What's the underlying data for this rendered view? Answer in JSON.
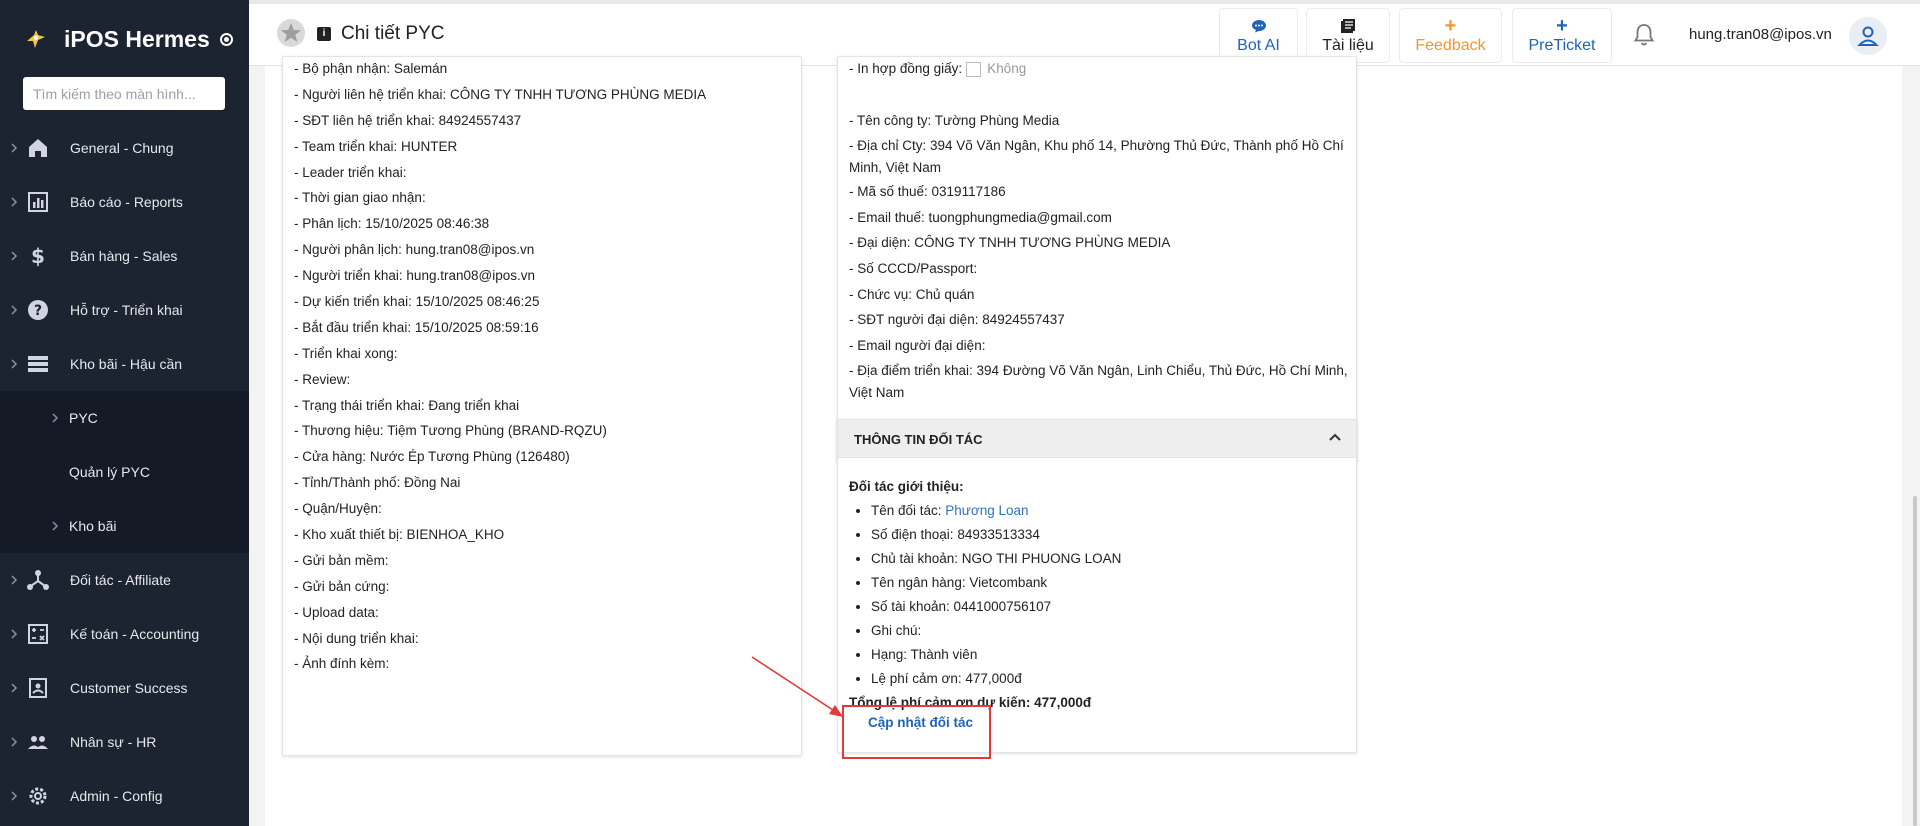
{
  "app": {
    "name": "iPOS Hermes"
  },
  "search": {
    "placeholder": "Tìm kiếm theo màn hình..."
  },
  "sidebar": {
    "items": [
      {
        "label": "General - Chung",
        "icon": "home-icon"
      },
      {
        "label": "Báo cáo - Reports",
        "icon": "chart-icon"
      },
      {
        "label": "Bán hàng - Sales",
        "icon": "dollar-icon"
      },
      {
        "label": "Hỗ trợ - Triển khai",
        "icon": "help-circle-icon"
      },
      {
        "label": "Kho bãi - Hậu cần",
        "icon": "list-icon"
      }
    ],
    "sub_items": [
      {
        "label": "PYC"
      },
      {
        "label": "Quản lý PYC"
      },
      {
        "label": "Kho bãi"
      }
    ],
    "items_after": [
      {
        "label": "Đối tác - Affiliate",
        "icon": "share-icon"
      },
      {
        "label": "Kế toán - Accounting",
        "icon": "calculator-icon"
      },
      {
        "label": "Customer Success",
        "icon": "badge-icon"
      },
      {
        "label": "Nhân sự - HR",
        "icon": "people-icon"
      },
      {
        "label": "Admin - Config",
        "icon": "gear-icon"
      }
    ]
  },
  "header": {
    "title": "Chi tiết PYC",
    "buttons": {
      "bot_ai": "Bot AI",
      "tai_lieu": "Tài liệu",
      "feedback": "Feedback",
      "preticket": "PreTicket"
    },
    "user_email": "hung.tran08@ipos.vn"
  },
  "colors": {
    "accent": "#1f63b9",
    "feedback": "#f0962d",
    "sidebar": "#1c2331",
    "highlight": "#e53935"
  },
  "left_card": {
    "lines": [
      "- Bộ phận nhận: Salemán",
      "- Người liên hệ triển khai: CÔNG TY TNHH TƯƠNG PHÙNG MEDIA",
      "- SĐT liên hệ triển khai: 84924557437",
      "- Team triển khai: HUNTER",
      "- Leader triển khai:",
      "- Thời gian giao nhận:",
      "- Phân lịch: 15/10/2025 08:46:38",
      "- Người phân lịch: hung.tran08@ipos.vn",
      "- Người triển khai: hung.tran08@ipos.vn",
      "- Dự kiến triển khai: 15/10/2025 08:46:25",
      "- Bắt đầu triển khai: 15/10/2025 08:59:16",
      "- Triển khai xong:",
      "- Review:",
      "- Trạng thái triển khai: Đang triển khai",
      "- Thương hiệu: Tiệm Tương Phùng (BRAND-RQZU)",
      "- Cửa hàng: Nước Ép Tương Phùng (126480)",
      "- Tỉnh/Thành phố: Đồng Nai",
      "- Quận/Huyện:",
      "- Kho xuất thiết bị: BIENHOA_KHO",
      "- Gửi bản mềm:",
      "- Gửi bản cứng:",
      "- Upload data:",
      "- Nội dung triển khai:",
      "- Ảnh đính kèm:"
    ]
  },
  "right_card": {
    "contract_label": "- In hợp đồng giấy:",
    "contract_value": "Không",
    "company": "- Tên công ty: Tường Phùng Media",
    "address": "- Địa chỉ Cty: 394 Võ Văn Ngân, Khu phố 14, Phường Thủ Đức, Thành phố Hồ Chí Minh, Việt Nam",
    "tax": "- Mã số thuế: 0319117186",
    "tax_email": "- Email thuế: tuongphungmedia@gmail.com",
    "representative": "- Đại diện: CÔNG TY TNHH TƯƠNG PHÙNG MEDIA",
    "id_card": "- Số CCCD/Passport:",
    "position": "- Chức vụ: Chủ quán",
    "rep_phone": "- SĐT người đại diện: 84924557437",
    "rep_email": "- Email người đại diện:",
    "location": "- Địa điểm triển khai: 394 Đường Võ Văn Ngân, Linh Chiểu, Thủ Đức, Hồ Chí Minh, Việt Nam"
  },
  "partner": {
    "title": "THÔNG TIN ĐỐI TÁC",
    "intro": "Đối tác giới thiệu:",
    "name_label": "Tên đối tác: ",
    "name_value": "Phương Loan",
    "phone": "Số điện thoại: 84933513334",
    "account_holder": "Chủ tài khoản: NGO THI PHUONG LOAN",
    "bank": "Tên ngân hàng: Vietcombank",
    "account_no": "Số tài khoản: 0441000756107",
    "note": "Ghi chú:",
    "rank": "Hạng: Thành viên",
    "fee": "Lệ phí cảm ơn: 477,000đ",
    "total": "Tổng lệ phí cảm ơn dự kiến: 477,000đ",
    "update_link": "Cập nhật đối tác"
  }
}
